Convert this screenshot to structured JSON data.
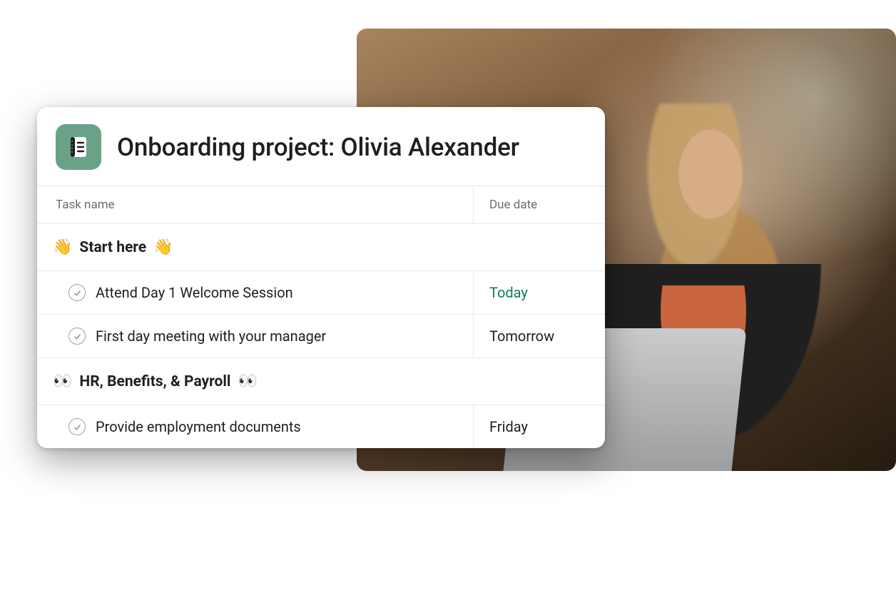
{
  "project": {
    "title": "Onboarding project: Olivia Alexander",
    "icon_name": "notebook-icon",
    "icon_bg": "#6aa288"
  },
  "columns": {
    "task": "Task name",
    "due": "Due date"
  },
  "sections": [
    {
      "emoji": "👋",
      "title": "Start here",
      "tasks": [
        {
          "name": "Attend Day 1 Welcome Session",
          "due": "Today",
          "due_accent": true
        },
        {
          "name": "First day meeting with your manager",
          "due": "Tomorrow",
          "due_accent": false
        }
      ]
    },
    {
      "emoji": "👀",
      "title": "HR, Benefits, & Payroll",
      "tasks": [
        {
          "name": "Provide employment documents",
          "due": "Friday",
          "due_accent": false
        }
      ]
    }
  ],
  "photo": {
    "alt": "Person working on a laptop in an office"
  }
}
